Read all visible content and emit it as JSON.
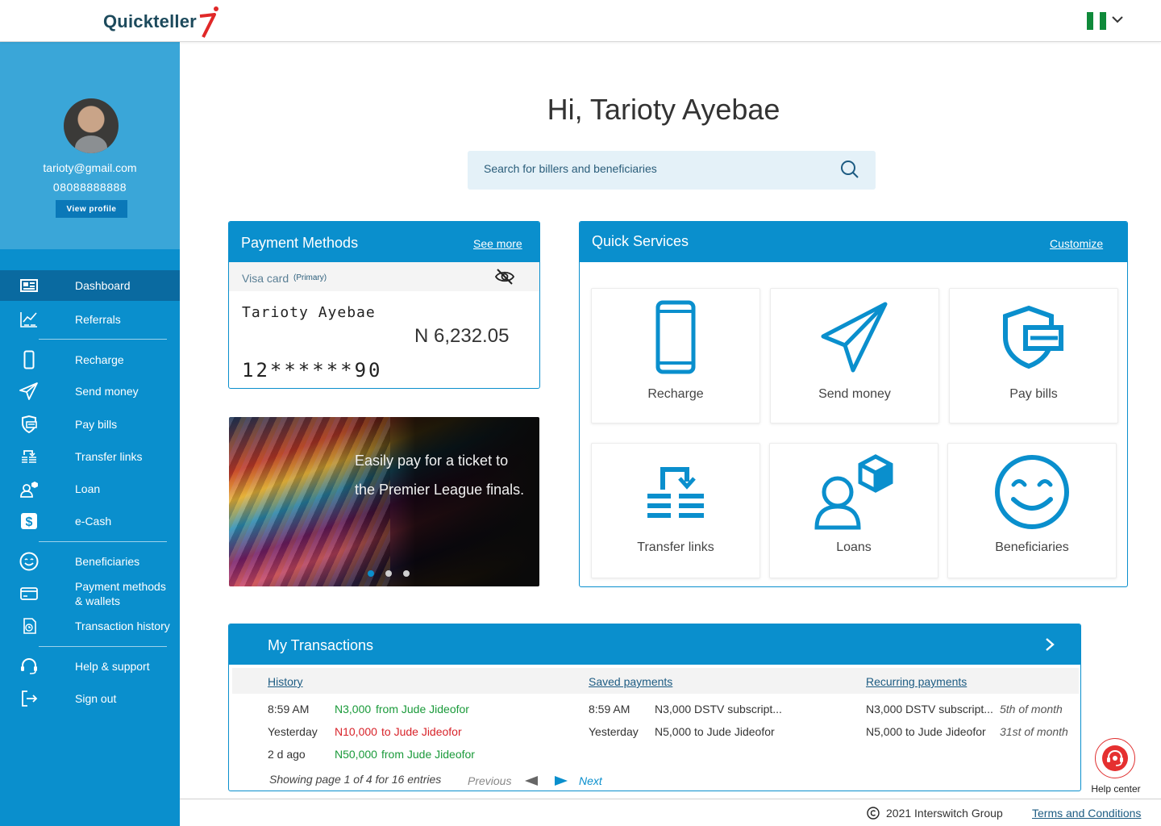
{
  "header": {
    "logo_text": "Quickteller",
    "flag_colors": [
      "#0f8a3a",
      "#ffffff",
      "#0f8a3a"
    ]
  },
  "profile": {
    "email": "tarioty@gmail.com",
    "phone": "08088888888",
    "view_profile": "View profile"
  },
  "sidebar": {
    "items": [
      {
        "label": "Dashboard",
        "icon": "dashboard-icon"
      },
      {
        "label": "Referrals",
        "icon": "referrals-icon"
      },
      {
        "label": "Recharge",
        "icon": "phone-icon"
      },
      {
        "label": "Send money",
        "icon": "send-icon"
      },
      {
        "label": "Pay bills",
        "icon": "bill-shield-icon"
      },
      {
        "label": "Transfer links",
        "icon": "transfer-links-icon"
      },
      {
        "label": "Loan",
        "icon": "loan-icon"
      },
      {
        "label": "e-Cash",
        "icon": "dollar-icon"
      },
      {
        "label": "Beneficiaries",
        "icon": "smiley-icon"
      },
      {
        "label": "Payment methods\n& wallets",
        "icon": "card-icon"
      },
      {
        "label": "Transaction history",
        "icon": "history-icon"
      },
      {
        "label": "Help & support",
        "icon": "headset-icon"
      },
      {
        "label": "Sign out",
        "icon": "signout-icon"
      }
    ]
  },
  "main": {
    "greeting": "Hi, Tarioty Ayebae",
    "search_placeholder": "Search for billers and beneficiaries"
  },
  "payment_methods": {
    "title": "Payment Methods",
    "see_more": "See more",
    "card_type": "Visa card",
    "primary": "(Primary)",
    "card_name": "Tarioty Ayebae",
    "balance": "N 6,232.05",
    "card_number": "12******90"
  },
  "banner": {
    "line1": "Easily pay for a  ticket to",
    "line2": "the Premier League finals."
  },
  "quick_services": {
    "title": "Quick Services",
    "customize": "Customize",
    "tiles": [
      "Recharge",
      "Send money",
      "Pay bills",
      "Transfer links",
      "Loans",
      "Beneficiaries"
    ]
  },
  "transactions": {
    "title": "My Transactions",
    "columns": {
      "history": "History",
      "saved": "Saved payments",
      "recurring": "Recurring payments"
    },
    "history": [
      {
        "time": "8:59 AM",
        "amount": "N3,000",
        "desc": "from Jude Jideofor",
        "kind": "credit"
      },
      {
        "time": "Yesterday",
        "amount": "N10,000",
        "desc": "to Jude Jideofor",
        "kind": "debit"
      },
      {
        "time": "2 d ago",
        "amount": "N50,000",
        "desc": "from Jude Jideofor",
        "kind": "credit"
      }
    ],
    "saved": [
      {
        "time": "8:59 AM",
        "desc": "N3,000 DSTV subscript..."
      },
      {
        "time": "Yesterday",
        "desc": "N5,000 to Jude Jideofor"
      }
    ],
    "recurring": [
      {
        "desc": "N3,000 DSTV subscript...",
        "when": "5th of month"
      },
      {
        "desc": "N5,000 to Jude Jideofor",
        "when": "31st of month"
      }
    ],
    "page_info": "Showing page 1 of 4 for 16 entries",
    "previous": "Previous",
    "next": "Next"
  },
  "help_center": "Help center",
  "footer": {
    "copyright": "2021 Interswitch Group",
    "terms": "Terms and Conditions"
  },
  "colors": {
    "primary": "#0a8fcd",
    "sidebar_active": "#0a6aa0",
    "credit": "#1a9a3a",
    "debit": "#d8232a"
  }
}
